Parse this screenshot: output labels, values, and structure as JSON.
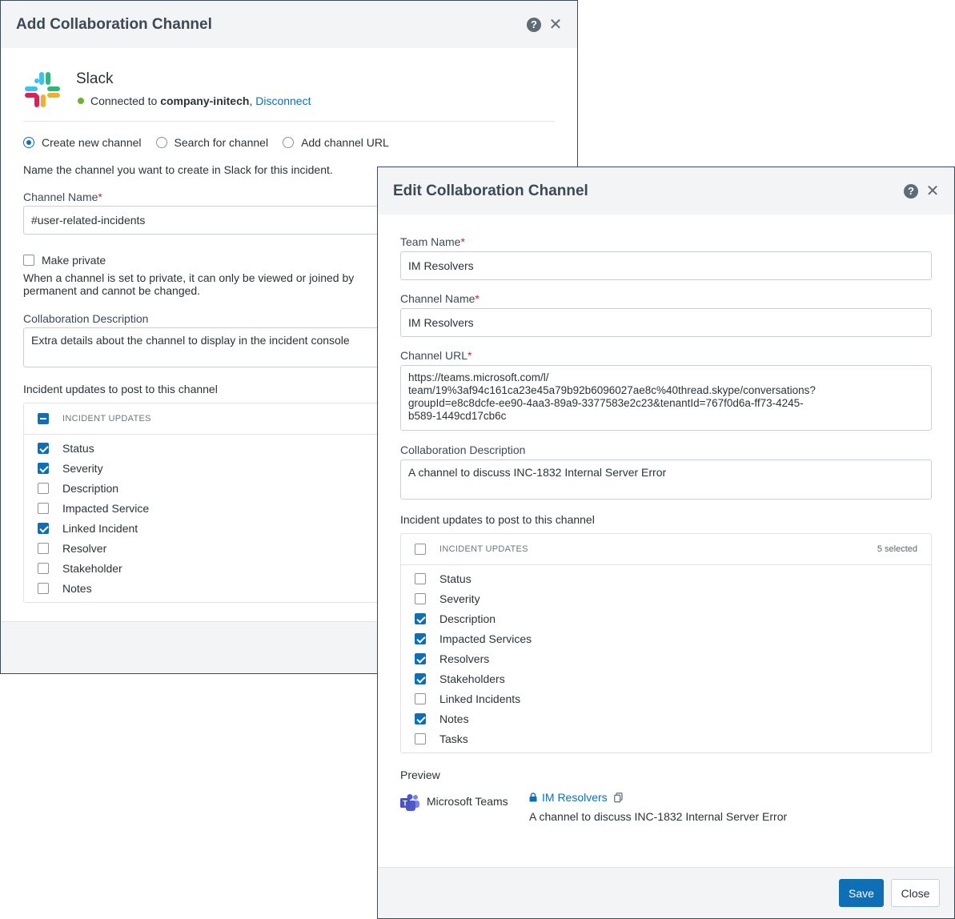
{
  "add_modal": {
    "title": "Add Collaboration Channel",
    "app_name": "Slack",
    "connected_prefix": "Connected to",
    "workspace": "company-initech",
    "separator": ",",
    "disconnect": "Disconnect",
    "status_color": "#6ab42e",
    "radios": [
      {
        "label": "Create new channel",
        "selected": true
      },
      {
        "label": "Search for channel",
        "selected": false
      },
      {
        "label": "Add channel URL",
        "selected": false
      }
    ],
    "instruction": "Name the channel you want to create in Slack for this incident.",
    "channel_name_label": "Channel Name",
    "channel_name_value": "#user-related-incidents",
    "make_private_label": "Make private",
    "private_note_line1": "When a channel is set to private, it can only be viewed or joined by",
    "private_note_line2": "permanent and cannot be changed.",
    "description_label": "Collaboration Description",
    "description_placeholder": "Extra details about the channel to display in the incident console",
    "updates_label": "Incident updates to post to this channel",
    "updates_header": "INCIDENT UPDATES",
    "updates": [
      {
        "label": "Status",
        "checked": true
      },
      {
        "label": "Severity",
        "checked": true
      },
      {
        "label": "Description",
        "checked": false
      },
      {
        "label": "Impacted Service",
        "checked": false
      },
      {
        "label": "Linked Incident",
        "checked": true
      },
      {
        "label": "Resolver",
        "checked": false
      },
      {
        "label": "Stakeholder",
        "checked": false
      },
      {
        "label": "Notes",
        "checked": false
      }
    ]
  },
  "edit_modal": {
    "title": "Edit Collaboration Channel",
    "team_name_label": "Team Name",
    "team_name_value": "IM Resolvers",
    "channel_name_label": "Channel Name",
    "channel_name_value": "IM Resolvers",
    "channel_url_label": "Channel URL",
    "channel_url_value": "https://teams.microsoft.com/l/\nteam/19%3af94c161ca23e45a79b92b6096027ae8c%40thread.skype/conversations?\ngroupId=e8c8dcfe-ee90-4aa3-89a9-3377583e2c23&tenantId=767f0d6a-ff73-4245-\nb589-1449cd17cb6c",
    "description_label": "Collaboration Description",
    "description_value": "A channel to discuss INC-1832 Internal Server Error",
    "updates_label": "Incident updates to post to this channel",
    "updates_header": "INCIDENT UPDATES",
    "updates_count": "5 selected",
    "updates": [
      {
        "label": "Status",
        "checked": false
      },
      {
        "label": "Severity",
        "checked": false
      },
      {
        "label": "Description",
        "checked": true
      },
      {
        "label": "Impacted Services",
        "checked": true
      },
      {
        "label": "Resolvers",
        "checked": true
      },
      {
        "label": "Stakeholders",
        "checked": true
      },
      {
        "label": "Linked Incidents",
        "checked": false
      },
      {
        "label": "Notes",
        "checked": true
      },
      {
        "label": "Tasks",
        "checked": false
      }
    ],
    "preview_label": "Preview",
    "preview_app": "Microsoft Teams",
    "preview_channel": "IM Resolvers",
    "preview_description": "A channel to discuss INC-1832 Internal Server Error",
    "save_label": "Save",
    "close_label": "Close"
  },
  "colors": {
    "primary": "#0e6fb7",
    "required": "#d1262f",
    "header_bg": "#f2f4f6"
  }
}
